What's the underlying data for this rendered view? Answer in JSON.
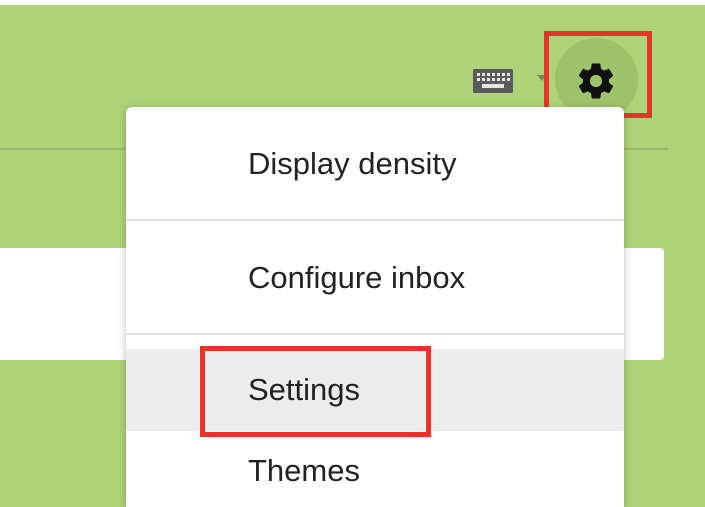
{
  "toolbar": {
    "keyboard_icon": "keyboard-icon",
    "dropdown_icon": "caret-down-icon",
    "gear_icon": "gear-icon"
  },
  "menu": {
    "items": [
      {
        "label": "Display density"
      },
      {
        "label": "Configure inbox"
      },
      {
        "label": "Settings",
        "highlighted": true
      },
      {
        "label": "Themes"
      }
    ]
  },
  "colors": {
    "background": "#aed277",
    "highlight": "#e8322a",
    "menu_hover": "#ececec"
  }
}
